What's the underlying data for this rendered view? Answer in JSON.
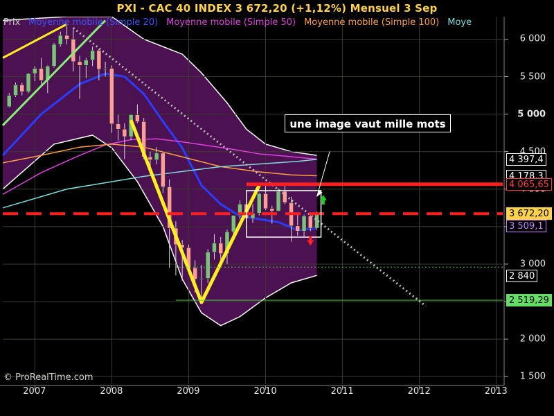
{
  "title": "PXI - CAC 40 INDEX    3 672,20 (+1,12%)    Mensuel  3 Sep",
  "legend": [
    {
      "label": "Prix",
      "color": "#cfcfcf"
    },
    {
      "label": "Moyenne mobile (Simple 20)",
      "color": "#3a55ff"
    },
    {
      "label": "Moyenne mobile (Simple 50)",
      "color": "#e040e0"
    },
    {
      "label": "Moyenne mobile (Simple 100)",
      "color": "#ffa040"
    },
    {
      "label": "Moye",
      "color": "#7fdddd"
    }
  ],
  "watermark": "© ProRealTime.com",
  "annotation": "une image vaut mille mots",
  "price_boxes": [
    {
      "value": 4397,
      "text": "4 397,4",
      "bg": "#000000",
      "fg": "#ffffff",
      "border": "#ffffff"
    },
    {
      "value": 4178,
      "text": "4 178,3",
      "bg": "#000000",
      "fg": "#ffffff",
      "border": "#ffffff"
    },
    {
      "value": 4065.65,
      "text": "4 065,65",
      "bg": "#000000",
      "fg": "#ff3b3b",
      "border": "#ff3b3b"
    },
    {
      "value": 3672.2,
      "text": "3 672,20",
      "bg": "#ffd24a",
      "fg": "#000000",
      "border": "#ffd24a"
    },
    {
      "value": 3509,
      "text": "3 509,1",
      "bg": "#000000",
      "fg": "#c080ff",
      "border": "#c080ff"
    },
    {
      "value": 2840,
      "text": "2 840",
      "bg": "#000000",
      "fg": "#ffffff",
      "border": "#ffffff"
    },
    {
      "value": 2519.29,
      "text": "2 519,29",
      "bg": "#66dd66",
      "fg": "#000000",
      "border": "#66dd66"
    }
  ],
  "chart_data": {
    "type": "candlestick",
    "ylim": [
      1400,
      6300
    ],
    "y_ticks": [
      {
        "value": 1500,
        "label": "1 500"
      },
      {
        "value": 2000,
        "label": "2 000"
      },
      {
        "value": 2500,
        "label": "2 500"
      },
      {
        "value": 3000,
        "label": "3 000"
      },
      {
        "value": 3500,
        "label": "3 500"
      },
      {
        "value": 4000,
        "label": "4 000"
      },
      {
        "value": 4500,
        "label": "4 500"
      },
      {
        "value": 5000,
        "label": "5 000"
      },
      {
        "value": 5500,
        "label": "5 500"
      },
      {
        "value": 6000,
        "label": "6 000"
      }
    ],
    "x_ticks": [
      "2007",
      "2008",
      "2009",
      "2010",
      "2011",
      "2012",
      "2013"
    ],
    "xlim": [
      "2006-08",
      "2013-02"
    ],
    "colors": {
      "background": "#000000",
      "grid": "#3a3a2e",
      "bollinger_fill": "#4b1150",
      "up": "#7fbf7f",
      "down": "#ff9b9b",
      "ma20": "#2a3cff",
      "ma50": "#e040e0",
      "ma100": "#ffa040",
      "ma200": "#7fdddd",
      "trend_yellow": "#ffee22",
      "trend_green": "#88ee77",
      "resistance": "#ff1f1f"
    },
    "candles": [
      [
        "2006-09",
        5100,
        5280,
        5090,
        5250
      ],
      [
        "2006-10",
        5250,
        5420,
        5230,
        5390
      ],
      [
        "2006-11",
        5390,
        5420,
        5250,
        5300
      ],
      [
        "2006-12",
        5300,
        5550,
        5280,
        5540
      ],
      [
        "2007-01",
        5540,
        5640,
        5440,
        5610
      ],
      [
        "2007-02",
        5610,
        5750,
        5400,
        5450
      ],
      [
        "2007-03",
        5450,
        5650,
        5280,
        5640
      ],
      [
        "2007-04",
        5640,
        5950,
        5620,
        5930
      ],
      [
        "2007-05",
        5930,
        6100,
        5900,
        6050
      ],
      [
        "2007-06",
        6050,
        6170,
        5930,
        6000
      ],
      [
        "2007-07",
        6000,
        6150,
        5570,
        5700
      ],
      [
        "2007-08",
        5700,
        5780,
        5200,
        5650
      ],
      [
        "2007-09",
        5650,
        5750,
        5480,
        5720
      ],
      [
        "2007-10",
        5720,
        5900,
        5640,
        5850
      ],
      [
        "2007-11",
        5850,
        5870,
        5450,
        5600
      ],
      [
        "2007-12",
        5600,
        5700,
        5500,
        5610
      ],
      [
        "2008-01",
        5610,
        5650,
        4750,
        4870
      ],
      [
        "2008-02",
        4870,
        4990,
        4650,
        4800
      ],
      [
        "2008-03",
        4800,
        4880,
        4400,
        4700
      ],
      [
        "2008-04",
        4700,
        5000,
        4650,
        4990
      ],
      [
        "2008-05",
        4990,
        5130,
        4880,
        4900
      ],
      [
        "2008-06",
        4900,
        4950,
        4400,
        4430
      ],
      [
        "2008-07",
        4430,
        4500,
        4200,
        4390
      ],
      [
        "2008-08",
        4390,
        4560,
        4330,
        4480
      ],
      [
        "2008-09",
        4480,
        4500,
        3950,
        4030
      ],
      [
        "2008-10",
        4030,
        4130,
        2950,
        3480
      ],
      [
        "2008-11",
        3480,
        3570,
        2850,
        3260
      ],
      [
        "2008-12",
        3260,
        3320,
        2780,
        3220
      ],
      [
        "2009-01",
        3220,
        3260,
        2930,
        2950
      ],
      [
        "2009-02",
        2950,
        3050,
        2620,
        2800
      ],
      [
        "2009-03",
        2800,
        2990,
        2500,
        2810
      ],
      [
        "2009-04",
        2810,
        3200,
        2750,
        3160
      ],
      [
        "2009-05",
        3160,
        3400,
        3060,
        3280
      ],
      [
        "2009-06",
        3280,
        3360,
        3060,
        3140
      ],
      [
        "2009-07",
        3140,
        3460,
        3000,
        3430
      ],
      [
        "2009-08",
        3430,
        3650,
        3380,
        3650
      ],
      [
        "2009-09",
        3650,
        3850,
        3600,
        3800
      ],
      [
        "2009-10",
        3800,
        3860,
        3560,
        3610
      ],
      [
        "2009-11",
        3610,
        3800,
        3550,
        3680
      ],
      [
        "2009-12",
        3680,
        3950,
        3650,
        3940
      ],
      [
        "2010-01",
        3940,
        4040,
        3720,
        3740
      ],
      [
        "2010-02",
        3740,
        3780,
        3540,
        3710
      ],
      [
        "2010-03",
        3710,
        4010,
        3700,
        3970
      ],
      [
        "2010-04",
        3970,
        4080,
        3800,
        3820
      ],
      [
        "2010-05",
        3820,
        3900,
        3300,
        3510
      ],
      [
        "2010-06",
        3510,
        3660,
        3380,
        3440
      ],
      [
        "2010-07",
        3440,
        3660,
        3370,
        3640
      ],
      [
        "2010-08",
        3640,
        3680,
        3440,
        3480
      ],
      [
        "2010-09",
        3480,
        3700,
        3460,
        3672
      ]
    ],
    "series": [
      {
        "name": "Moyenne mobile (Simple 20)",
        "color": "#2a3cff",
        "points": [
          [
            "2006-08",
            4450
          ],
          [
            "2007-02",
            5000
          ],
          [
            "2007-08",
            5400
          ],
          [
            "2007-12",
            5540
          ],
          [
            "2008-03",
            5500
          ],
          [
            "2008-06",
            5270
          ],
          [
            "2008-09",
            4900
          ],
          [
            "2008-12",
            4550
          ],
          [
            "2009-03",
            4050
          ],
          [
            "2009-06",
            3800
          ],
          [
            "2009-09",
            3640
          ],
          [
            "2009-12",
            3600
          ],
          [
            "2010-03",
            3560
          ],
          [
            "2010-06",
            3450
          ],
          [
            "2010-09",
            3480
          ]
        ]
      },
      {
        "name": "Moyenne mobile (Simple 50)",
        "color": "#e040e0",
        "points": [
          [
            "2006-08",
            3930
          ],
          [
            "2007-02",
            4220
          ],
          [
            "2007-08",
            4450
          ],
          [
            "2007-12",
            4590
          ],
          [
            "2008-04",
            4660
          ],
          [
            "2008-08",
            4670
          ],
          [
            "2008-12",
            4630
          ],
          [
            "2009-04",
            4580
          ],
          [
            "2009-08",
            4530
          ],
          [
            "2009-12",
            4470
          ],
          [
            "2010-04",
            4440
          ],
          [
            "2010-09",
            4400
          ]
        ]
      },
      {
        "name": "Moyenne mobile (Simple 100)",
        "color": "#ffa040",
        "points": [
          [
            "2006-08",
            4350
          ],
          [
            "2007-02",
            4450
          ],
          [
            "2007-08",
            4560
          ],
          [
            "2008-01",
            4600
          ],
          [
            "2008-06",
            4560
          ],
          [
            "2008-12",
            4430
          ],
          [
            "2009-06",
            4300
          ],
          [
            "2009-12",
            4230
          ],
          [
            "2010-05",
            4190
          ],
          [
            "2010-09",
            4178
          ]
        ]
      },
      {
        "name": "Moye",
        "color": "#7fdddd",
        "points": [
          [
            "2006-08",
            3750
          ],
          [
            "2007-06",
            4000
          ],
          [
            "2008-06",
            4170
          ],
          [
            "2009-06",
            4300
          ],
          [
            "2010-06",
            4370
          ],
          [
            "2010-09",
            4397
          ]
        ]
      }
    ],
    "bollinger": {
      "upper": [
        [
          "2006-08",
          6250
        ],
        [
          "2007-06",
          6300
        ],
        [
          "2008-01",
          6300
        ],
        [
          "2008-06",
          6000
        ],
        [
          "2008-12",
          5800
        ],
        [
          "2009-03",
          5550
        ],
        [
          "2009-07",
          5150
        ],
        [
          "2009-10",
          4800
        ],
        [
          "2010-01",
          4600
        ],
        [
          "2010-05",
          4500
        ],
        [
          "2010-09",
          4450
        ]
      ],
      "lower": [
        [
          "2006-08",
          4000
        ],
        [
          "2007-04",
          4600
        ],
        [
          "2007-10",
          4720
        ],
        [
          "2008-01",
          4550
        ],
        [
          "2008-05",
          4100
        ],
        [
          "2008-09",
          3500
        ],
        [
          "2008-12",
          2800
        ],
        [
          "2009-03",
          2350
        ],
        [
          "2009-06",
          2180
        ],
        [
          "2009-09",
          2300
        ],
        [
          "2010-01",
          2550
        ],
        [
          "2010-05",
          2750
        ],
        [
          "2010-09",
          2850
        ]
      ]
    },
    "lines": [
      {
        "name": "yellow-trend-top",
        "color": "#ffee22",
        "width": 3,
        "points": [
          [
            "2006-08",
            5750
          ],
          [
            "2007-06",
            6200
          ]
        ]
      },
      {
        "name": "green-channel",
        "color": "#88ee77",
        "width": 3,
        "points": [
          [
            "2006-08",
            4850
          ],
          [
            "2007-12",
            6250
          ]
        ]
      },
      {
        "name": "yellow-zigzag",
        "color": "#ffee22",
        "width": 5,
        "points": [
          [
            "2008-04",
            4920
          ],
          [
            "2009-03",
            2490
          ],
          [
            "2009-12",
            4050
          ]
        ]
      },
      {
        "name": "white-dotted-downtrend",
        "color": "#bbbbbb",
        "width": 3,
        "dash": "2,4",
        "points": [
          [
            "2007-07",
            6150
          ],
          [
            "2012-02",
            2440
          ]
        ]
      },
      {
        "name": "resistance",
        "color": "#ff1f1f",
        "width": 5,
        "points": [
          [
            "2009-10",
            4065
          ],
          [
            "2013-02",
            4065
          ]
        ]
      },
      {
        "name": "dashed-support",
        "color": "#ff1f1f",
        "width": 4,
        "dash": "22,12",
        "points": [
          [
            "2006-08",
            3672
          ],
          [
            "2013-02",
            3672
          ]
        ]
      },
      {
        "name": "green-dotted-level",
        "color": "#55cc55",
        "width": 1,
        "dash": "2,3",
        "points": [
          [
            "2008-11",
            2960
          ],
          [
            "2013-02",
            2960
          ]
        ]
      },
      {
        "name": "green-solid-level",
        "color": "#55cc55",
        "width": 1,
        "points": [
          [
            "2008-11",
            2519
          ],
          [
            "2013-02",
            2519
          ]
        ]
      },
      {
        "name": "white-arrow-line",
        "color": "#ffffff",
        "width": 1,
        "points": [
          [
            "2010-09",
            3900
          ],
          [
            "2010-11",
            4500
          ]
        ]
      }
    ],
    "boxes": [
      {
        "name": "consolidation-box",
        "color": "#ffffff",
        "from": [
          "2009-10",
          3360
        ],
        "to": [
          "2010-09",
          3980
        ]
      }
    ],
    "arrows": [
      {
        "name": "up-arrow",
        "color": "#22cc22",
        "at": [
          "2010-10",
          3850
        ],
        "dir": "up"
      },
      {
        "name": "down-arrow",
        "color": "#ff2222",
        "at": [
          "2010-08",
          3320
        ],
        "dir": "down"
      }
    ]
  }
}
